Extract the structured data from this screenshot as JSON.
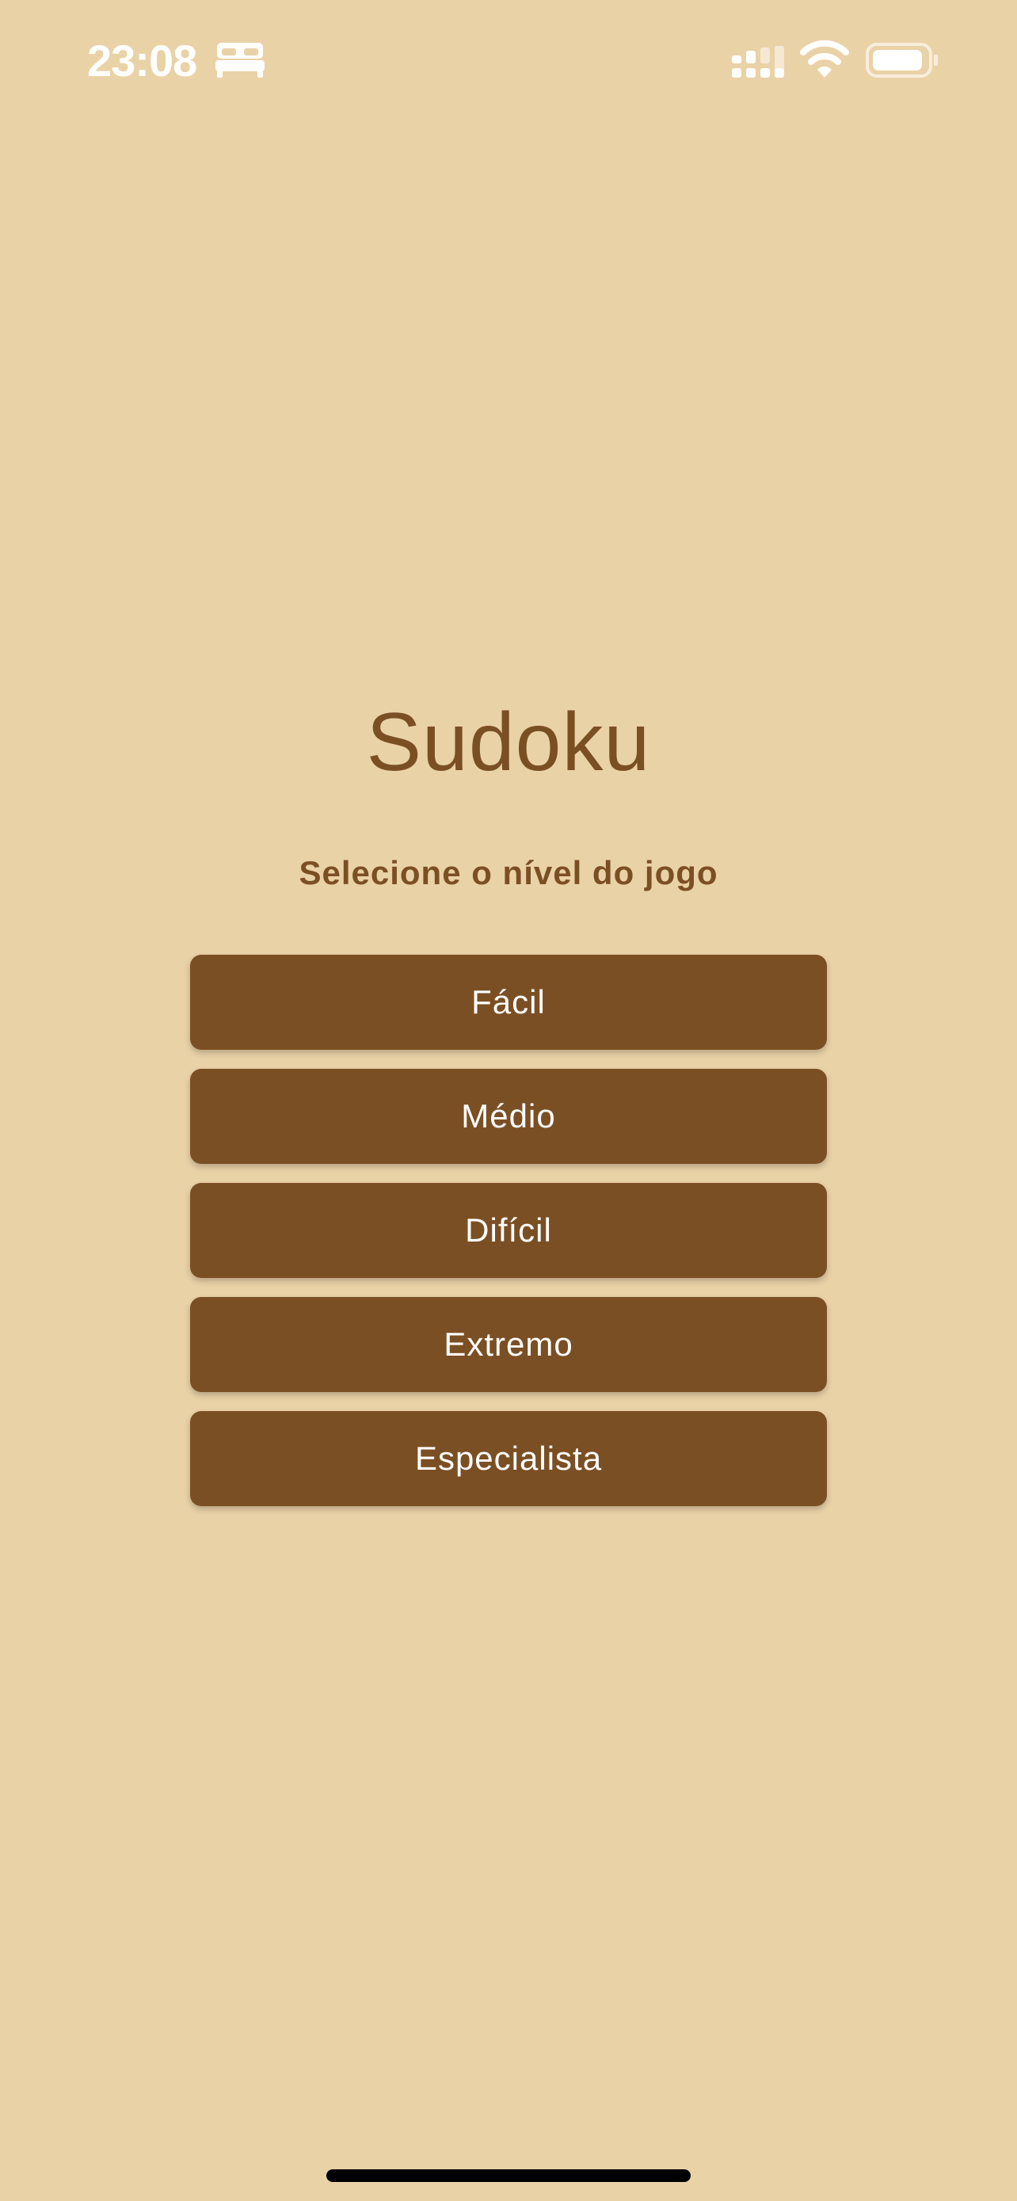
{
  "status_bar": {
    "time": "23:08",
    "icons": [
      "bed-icon",
      "cellular-signal-icon",
      "wifi-icon",
      "battery-icon"
    ]
  },
  "main": {
    "title": "Sudoku",
    "subtitle": "Selecione o nível do jogo",
    "levels": [
      {
        "label": "Fácil"
      },
      {
        "label": "Médio"
      },
      {
        "label": "Difícil"
      },
      {
        "label": "Extremo"
      },
      {
        "label": "Especialista"
      }
    ]
  },
  "colors": {
    "background": "#EAD2A7",
    "accent": "#7B4F24",
    "button_text": "#FFFFFF"
  }
}
